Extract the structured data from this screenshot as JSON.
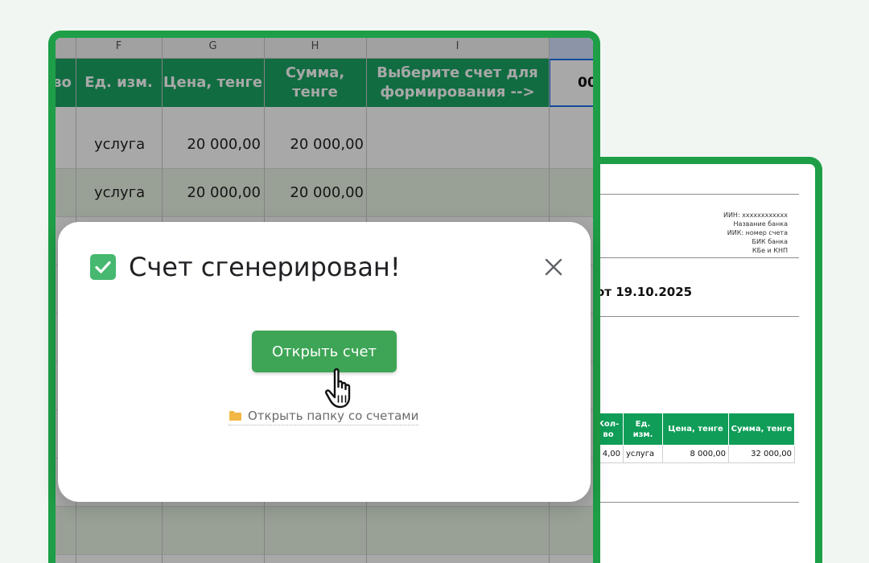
{
  "sheet": {
    "columns": [
      "F",
      "G",
      "H",
      "I"
    ],
    "headers": [
      "во",
      "Ед. изм.",
      "Цена, тенге",
      "Сумма,\nтенге",
      "Выберите счет для\nформирования -->"
    ],
    "selected_cell_value": "00",
    "rows": [
      {
        "unit": "услуга",
        "price": "20 000,00",
        "sum": "20 000,00"
      },
      {
        "unit": "услуга",
        "price": "20 000,00",
        "sum": "20 000,00"
      }
    ]
  },
  "invoice": {
    "requisites": [
      "ИИН: хххххххххххх",
      "Название банка",
      "ИИК: номер счета",
      "БИК банка",
      "КБе и КНП"
    ],
    "date_line": "от 19.10.2025",
    "table": {
      "headers": [
        "Кол-\nво",
        "Ед.\nизм.",
        "Цена, тенге",
        "Сумма, тенге"
      ],
      "row": {
        "qty": "4,00",
        "unit": "услуга",
        "price": "8 000,00",
        "sum": "32 000,00"
      }
    }
  },
  "dialog": {
    "title": "Счет сгенерирован!",
    "open_button_label": "Открыть счет",
    "folder_link_label": "Открыть папку со счетами"
  },
  "colors": {
    "frame_green": "#1e9e46",
    "header_green": "#1aa563",
    "button_green": "#3ea556",
    "check_green": "#46b86f"
  }
}
